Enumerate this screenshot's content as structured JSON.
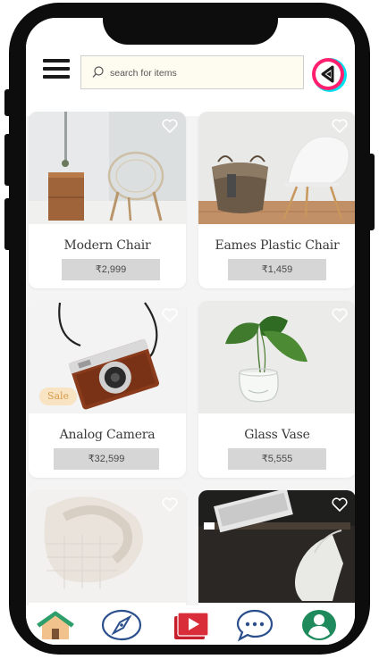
{
  "header": {
    "search": {
      "placeholder": "search for items"
    }
  },
  "products": [
    {
      "name": "Modern Chair",
      "price": "₹2,999"
    },
    {
      "name": "Eames Plastic Chair",
      "price": "₹1,459"
    },
    {
      "name": "Analog Camera",
      "price": "₹32,599",
      "badge": "Sale"
    },
    {
      "name": "Glass Vase",
      "price": "₹5,555"
    }
  ],
  "tabbar": {
    "items": [
      "home-icon",
      "compass-icon",
      "video-icon",
      "chat-icon",
      "profile-icon"
    ]
  },
  "colors": {
    "header_bg": "#ffffff",
    "screen_bg": "#f4f4f4",
    "price_bg": "#d6d6d6",
    "sale_badge_bg": "#f8e4c3",
    "sale_badge_text": "#d89b4a",
    "tab_home": "#2e9e6b",
    "tab_compass": "#2a4f8c",
    "tab_video": "#c61f2b",
    "tab_chat": "#2a4f8c",
    "tab_profile": "#1f8a5c"
  }
}
